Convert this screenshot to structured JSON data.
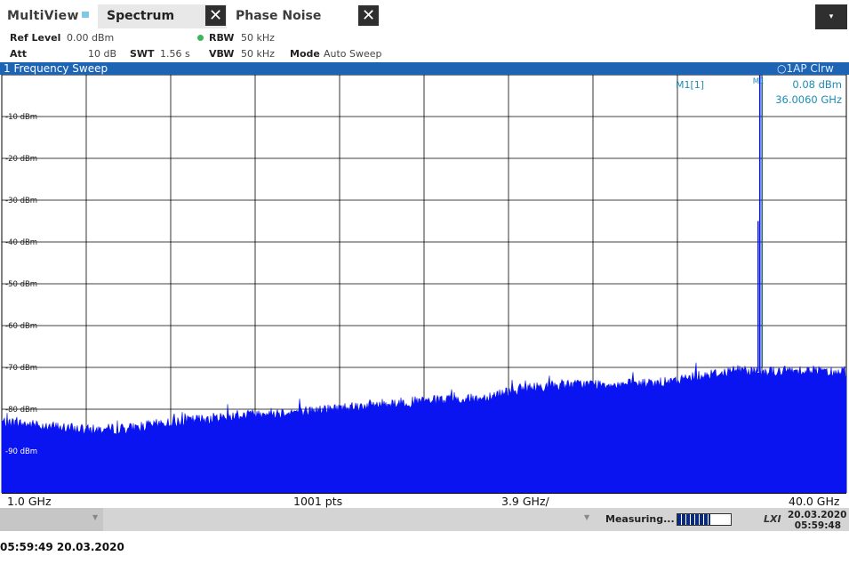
{
  "tabs": {
    "multiview": "MultiView",
    "spectrum": "Spectrum",
    "phase_noise": "Phase Noise",
    "close_glyph": "✕",
    "menu_glyph": "▾"
  },
  "settings": {
    "ref_level_label": "Ref Level",
    "ref_level_value": "0.00 dBm",
    "att_label": "Att",
    "att_value": "10 dB",
    "swt_label": "SWT",
    "swt_value": "1.56 s",
    "rbw_label": "RBW",
    "rbw_value": "50 kHz",
    "vbw_label": "VBW",
    "vbw_value": "50 kHz",
    "mode_label": "Mode",
    "mode_value": "Auto Sweep"
  },
  "diagram": {
    "title": "1 Frequency Sweep",
    "trace_info": "○1AP Clrw",
    "marker": {
      "name": "M1[1]",
      "flag": "M1",
      "level": "0.08 dBm",
      "frequency": "36.0060 GHz"
    },
    "footer": {
      "start": "1.0 GHz",
      "points": "1001 pts",
      "span": "3.9 GHz/",
      "stop": "40.0 GHz"
    }
  },
  "chart_data": {
    "type": "line",
    "title": "1 Frequency Sweep",
    "xlabel": "",
    "ylabel": "",
    "x_range_ghz": [
      1.0,
      40.0
    ],
    "ylim": [
      -100,
      0
    ],
    "y_tick_labels": [
      "-10 dBm",
      "-20 dBm",
      "-30 dBm",
      "-40 dBm",
      "-50 dBm",
      "-60 dBm",
      "-70 dBm",
      "-80 dBm",
      "-90 dBm"
    ],
    "grid": true,
    "series": [
      {
        "x": [
          1.0,
          3.0,
          5.0,
          7.0,
          9.0,
          11.0,
          13.0,
          15.0,
          17.0,
          19.0,
          21.0,
          23.0,
          24.5,
          26.0,
          28.0,
          30.0,
          32.0,
          33.0,
          34.0,
          35.0,
          35.9,
          36.006,
          36.1,
          37.0,
          38.0,
          39.0,
          40.0
        ],
        "y": [
          -83,
          -84,
          -85,
          -84.5,
          -83,
          -82,
          -81,
          -80.5,
          -79.5,
          -78.5,
          -78,
          -77.5,
          -75.5,
          -74.5,
          -74,
          -74,
          -73.5,
          -72,
          -71.5,
          -70.5,
          -71,
          0.08,
          -71,
          -71,
          -70.5,
          -71,
          -71
        ]
      }
    ],
    "marker": {
      "x": 36.006,
      "y": 0.08
    }
  },
  "status": {
    "measuring": "Measuring...",
    "progress": 0.62,
    "lxi": "LXI",
    "date": "20.03.2020",
    "time": "05:59:48"
  },
  "timestamp": "05:59:49  20.03.2020"
}
